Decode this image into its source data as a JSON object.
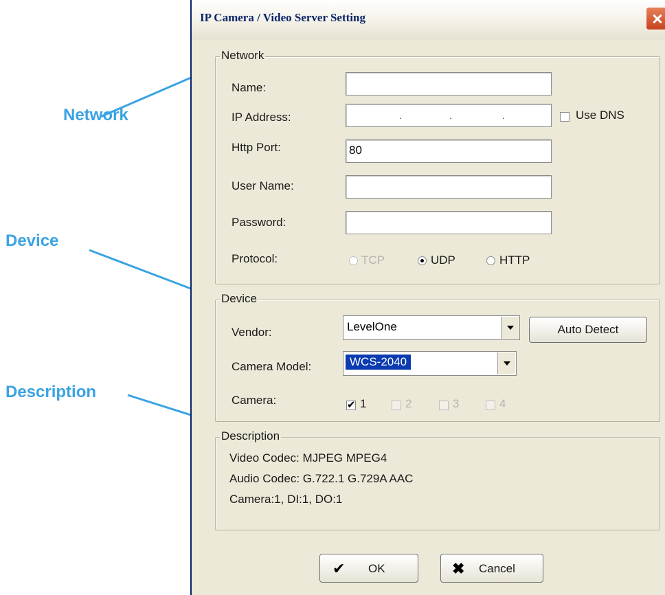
{
  "callouts": {
    "network": "Network",
    "device": "Device",
    "description": "Description"
  },
  "dialog": {
    "title": "IP Camera / Video Server Setting",
    "close_icon": "close-icon"
  },
  "network": {
    "group_label": "Network",
    "name_label": "Name:",
    "name_value": "",
    "ip_label": "IP Address:",
    "ip_value": "",
    "use_dns_label": "Use DNS",
    "use_dns_checked": false,
    "http_port_label": "Http Port:",
    "http_port_value": "80",
    "user_name_label": "User Name:",
    "user_name_value": "",
    "password_label": "Password:",
    "password_value": "",
    "protocol_label": "Protocol:",
    "protocol_options": [
      "TCP",
      "UDP",
      "HTTP"
    ],
    "protocol_selected": "UDP"
  },
  "device": {
    "group_label": "Device",
    "vendor_label": "Vendor:",
    "vendor_value": "LevelOne",
    "auto_detect_label": "Auto Detect",
    "model_label": "Camera Model:",
    "model_value": "WCS-2040",
    "camera_label": "Camera:",
    "cameras": [
      {
        "label": "1",
        "checked": true,
        "enabled": true
      },
      {
        "label": "2",
        "checked": false,
        "enabled": false
      },
      {
        "label": "3",
        "checked": false,
        "enabled": false
      },
      {
        "label": "4",
        "checked": false,
        "enabled": false
      }
    ]
  },
  "description": {
    "group_label": "Description",
    "lines": [
      "Video Codec: MJPEG MPEG4",
      "Audio Codec: G.722.1 G.729A AAC",
      "Camera:1, DI:1, DO:1"
    ]
  },
  "buttons": {
    "ok_label": "OK",
    "ok_icon": "checkmark-icon",
    "cancel_label": "Cancel",
    "cancel_icon": "x-icon"
  },
  "colors": {
    "accent": "#3aa3e3",
    "title_blue": "#0a246a",
    "dialog_bg": "#ece9d8",
    "selection": "#0a3bb0"
  }
}
